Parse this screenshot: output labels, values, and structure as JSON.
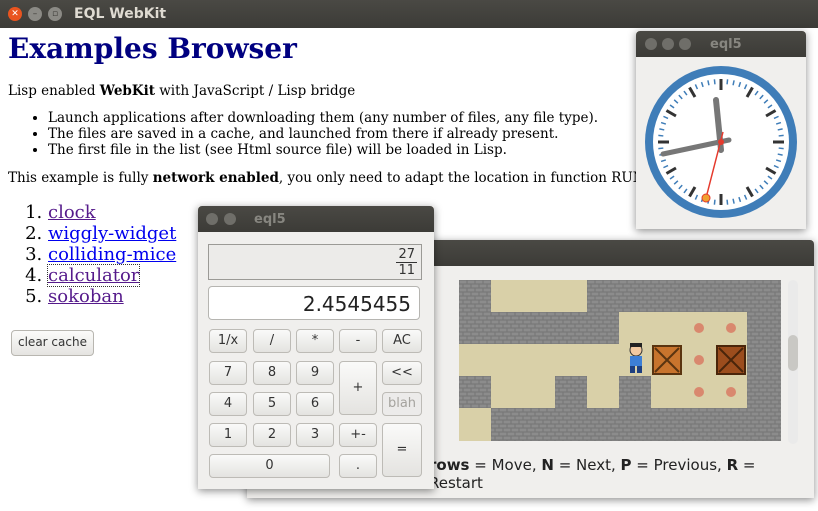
{
  "window": {
    "title": "EQL WebKit"
  },
  "page": {
    "heading": "Examples Browser",
    "intro_prefix": "Lisp enabled ",
    "intro_bold": "WebKit",
    "intro_suffix": " with JavaScript / Lisp bridge",
    "bullets": [
      "Launch applications after downloading them (any number of files, any file type).",
      "The files are saved in a cache, and launched from there if already present.",
      "The first file in the list (see Html source file) will be loaded in Lisp."
    ],
    "net_prefix": "This example is fully ",
    "net_bold": "network enabled",
    "net_suffix": ", you only need to adapt the location in function RUN.",
    "links": [
      "clock",
      "wiggly-widget",
      "colliding-mice",
      "calculator",
      "sokoban"
    ],
    "clear_button": "clear cache"
  },
  "clock_window": {
    "title": "eql5"
  },
  "calc_window": {
    "title": "eql5",
    "fraction_num": "27",
    "fraction_den": "11",
    "display": "2.4545455",
    "buttons": {
      "inv": "1/x",
      "div": "/",
      "mul": "*",
      "sub": "-",
      "ac": "AC",
      "n7": "7",
      "n8": "8",
      "n9": "9",
      "add": "+",
      "back": "<<",
      "n4": "4",
      "n5": "5",
      "n6": "6",
      "blah": "blah",
      "n1": "1",
      "n2": "2",
      "n3": "3",
      "neg": "+-",
      "eq": "=",
      "n0": "0",
      "dot": "."
    }
  },
  "sokoban_window": {
    "help": {
      "arrows_bold": "rows",
      "arrows_text": " = Move, ",
      "n_bold": "N",
      "n_text": " = Next, ",
      "p_bold": "P",
      "p_text": " = Previous, ",
      "r_bold": "R",
      "r_text": " = Restart"
    }
  },
  "colors": {
    "heading": "#000080",
    "link_visited": "#551a8b",
    "link": "#0000ee",
    "clock_rim": "#3f7db8"
  }
}
